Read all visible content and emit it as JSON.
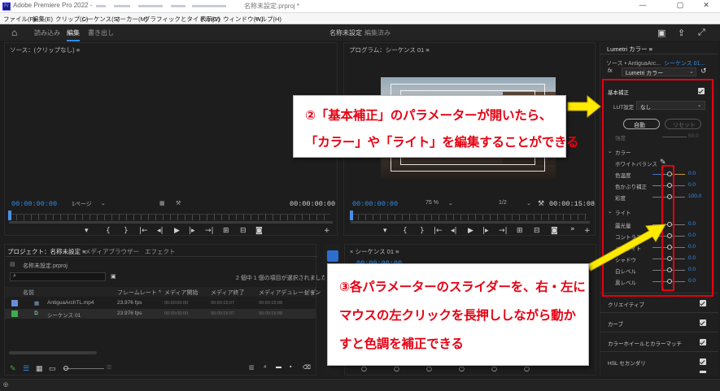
{
  "titlebar": {
    "app_icon": "Pr",
    "title": "Adobe Premiere Pro 2022 -",
    "file": "名称未設定.prproj *",
    "minimize": "—",
    "maximize": "▢",
    "close": "✕"
  },
  "menu": [
    "ファイル(F)",
    "編集(E)",
    "クリップ(C)",
    "シーケンス(S)",
    "マーカー(M)",
    "グラフィックとタイトル(G)",
    "表示(V)",
    "ウィンドウ(W)",
    "ヘルプ(H)"
  ],
  "workspace": {
    "home_icon": "home-icon",
    "tabs": [
      "読み込み",
      "編集",
      "書き出し"
    ],
    "active_tab": "編集",
    "project_name": "名称未設定",
    "project_status": "編集済み"
  },
  "source": {
    "header": "ソース：(クリップなし)  ≡",
    "timecode_left": "00:00:00:00",
    "zoom": "1ページ",
    "timecode_right": "00:00:00:00"
  },
  "program": {
    "header": "プログラム：シーケンス 01  ≡",
    "timecode_left": "00:00:00:00",
    "zoom": "75 %",
    "resolution": "1/2",
    "timecode_right": "00:00:15:08"
  },
  "project": {
    "tabs": [
      "プロジェクト：名称未設定  ≡",
      "メディアブラウザー",
      "エフェクト"
    ],
    "file_name": "名称未設定.prproj",
    "selection_info": "2 個中 1 個の項目が選択されました",
    "columns": [
      "名前",
      "フレームレート ^",
      "メディア開始",
      "メディア終了",
      "メディアデュレーション",
      "ビデ"
    ],
    "items": [
      {
        "name": "AntiguaArchTL.mp4",
        "fps": "23.976 fps",
        "start": "00:00:00:00",
        "end": "00:00:15:07",
        "duration": "00:00:15:08",
        "color": "#6a8fd8"
      },
      {
        "name": "シーケンス 01",
        "fps": "23.976 fps",
        "start": "00:00:00:00",
        "end": "00:00:15:07",
        "duration": "00:00:15:08",
        "color": "#3fae4a"
      }
    ]
  },
  "timeline": {
    "header": "×  シーケンス 01  ≡",
    "timecode": "00:00:00:00"
  },
  "lumetri": {
    "panel_title": "Lumetri カラー  ≡",
    "source_label": "ソース • AntiguaArc...",
    "sequence_label": "シーケンス 01...",
    "fx_label": "Lumetri カラー",
    "basic_correction": "基本補正",
    "lut_label": "LUT設定",
    "lut_value": "なし",
    "auto_button": "自動",
    "reset_button": "リセット",
    "strength_label": "強度",
    "strength_value": "50.0",
    "color_section": "カラー",
    "white_balance": "ホワイトバランス",
    "color_sliders": [
      {
        "label": "色温度",
        "value": "0.0"
      },
      {
        "label": "色かぶり補正",
        "value": "0.0"
      },
      {
        "label": "彩度",
        "value": "100.0"
      }
    ],
    "light_section": "ライト",
    "light_sliders": [
      {
        "label": "露光量",
        "value": "0.0"
      },
      {
        "label": "コントラスト",
        "value": "0.0"
      },
      {
        "label": "ハイライト",
        "value": "0.0"
      },
      {
        "label": "シャドウ",
        "value": "0.0"
      },
      {
        "label": "白レベル",
        "value": "0.0"
      },
      {
        "label": "黒レベル",
        "value": "0.0"
      }
    ],
    "sections": [
      "クリエイティブ",
      "カーブ",
      "カラーホイールとカラーマッチ",
      "HSL セカンダリ"
    ]
  },
  "annotations": {
    "callout1_line1": "②「基本補正」のパラメーターが開いたら、",
    "callout1_line2": "「カラー」や「ライト」を編集することができる",
    "callout2_line1": "③各パラメーターのスライダーを、右・左に",
    "callout2_line2": "マウスの左クリックを長押ししながら動か",
    "callout2_line3": "すと色調を補正できる",
    "accent_color": "#e60012",
    "arrow_color": "#ffea00"
  }
}
